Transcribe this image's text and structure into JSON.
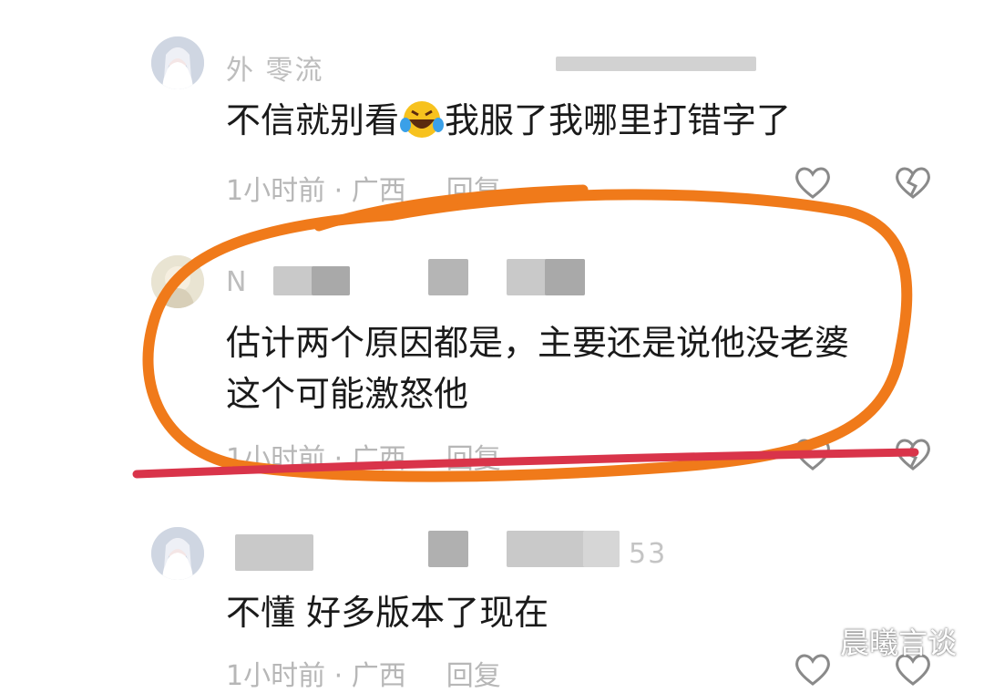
{
  "comments": [
    {
      "username": "外    零流",
      "username_tail": "",
      "text_line1": "不信就别看",
      "emoji": "rofl-emoji",
      "text_line1_after": "我服了我哪里打错字了",
      "time": "1小时前",
      "sep": " · ",
      "location": "广西",
      "reply": "回复"
    },
    {
      "username": "N",
      "username_tail": "",
      "text_line1": "估计两个原因都是，主要还是说他没老婆",
      "text_line2": "这个可能激怒他",
      "time": "1小时前",
      "sep": " · ",
      "location": "广西",
      "reply": "回复"
    },
    {
      "username": "",
      "username_tail": "53",
      "text_line1": "不懂 好多版本了现在",
      "time": "1小时前",
      "sep": " · ",
      "location": "广西",
      "reply": "回复"
    }
  ],
  "watermark": "晨曦言谈",
  "colors": {
    "highlight_ellipse": "#f07a1a",
    "underline": "#d9344a",
    "meta_text": "#b7b7b7",
    "body_text": "#1a1a1a"
  },
  "icons": [
    "avatar",
    "like-heart-icon",
    "dislike-broken-heart-icon",
    "rofl-emoji"
  ]
}
